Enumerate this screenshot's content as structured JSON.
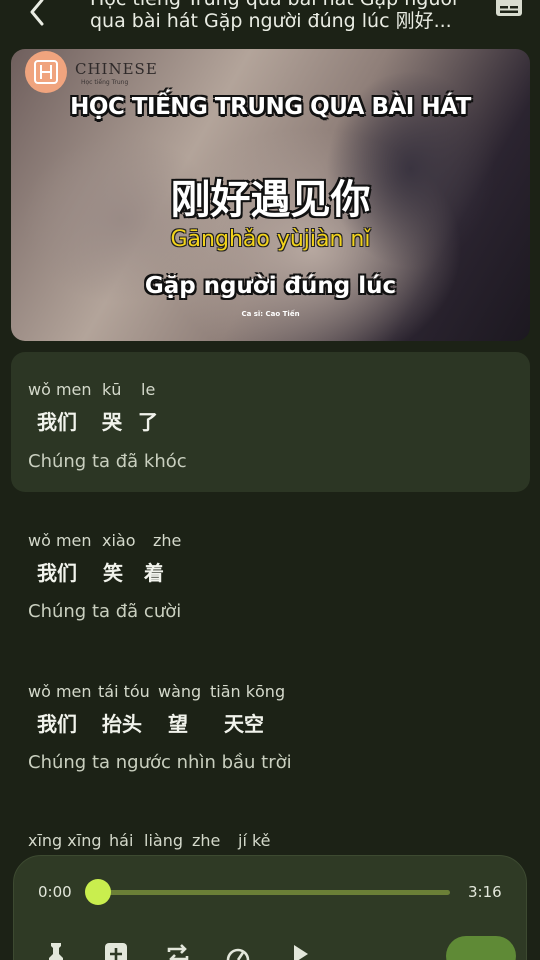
{
  "header": {
    "title_top": "Học tiếng Trung qua bài hát Gặp người",
    "title": "qua bài hát Gặp người đúng lúc 刚好..."
  },
  "banner": {
    "logo_text": "CHINESE",
    "logo_sub": "Học tiếng Trung",
    "title": "HỌC TIẾNG TRUNG QUA BÀI HÁT",
    "hanzi": "刚好遇见你",
    "pinyin": "Gānghǎo yùjiàn nǐ",
    "vietnamese": "Gặp người đúng lúc",
    "singer": "Ca sĩ: Cao Tiến"
  },
  "lyrics": [
    {
      "pinyin": [
        "wǒ men",
        "kū",
        "le"
      ],
      "hanzi": [
        "我们",
        "哭",
        "了"
      ],
      "translation": "Chúng ta đã khóc",
      "active": true
    },
    {
      "pinyin": [
        "wǒ men",
        "xiào",
        "zhe"
      ],
      "hanzi": [
        "我们",
        "笑",
        "着"
      ],
      "translation": "Chúng ta đã cười",
      "active": false
    },
    {
      "pinyin": [
        "wǒ men",
        "tái tóu",
        "wàng",
        "tiān kōng"
      ],
      "hanzi": [
        "我们",
        "抬头",
        "望",
        "天空"
      ],
      "translation": "Chúng ta ngước nhìn bầu trời",
      "active": false
    },
    {
      "pinyin": [
        "xīng xīng",
        "hái",
        "liàng",
        "zhe",
        "jí kě"
      ],
      "hanzi": [],
      "translation": "",
      "active": false
    }
  ],
  "player": {
    "current_time": "0:00",
    "duration": "3:16",
    "progress": 0.0
  },
  "icons": {
    "back": "chevron-left-icon",
    "subtitles": "subtitles-icon",
    "pin": "pin-icon",
    "add": "add-box-icon",
    "repeat": "repeat-icon",
    "speed": "speed-icon",
    "play": "play-icon"
  },
  "colors": {
    "background": "#1c2216",
    "card": "#2c3624",
    "accent": "#c9ee4e",
    "banner_pinyin": "#f2d31b"
  }
}
